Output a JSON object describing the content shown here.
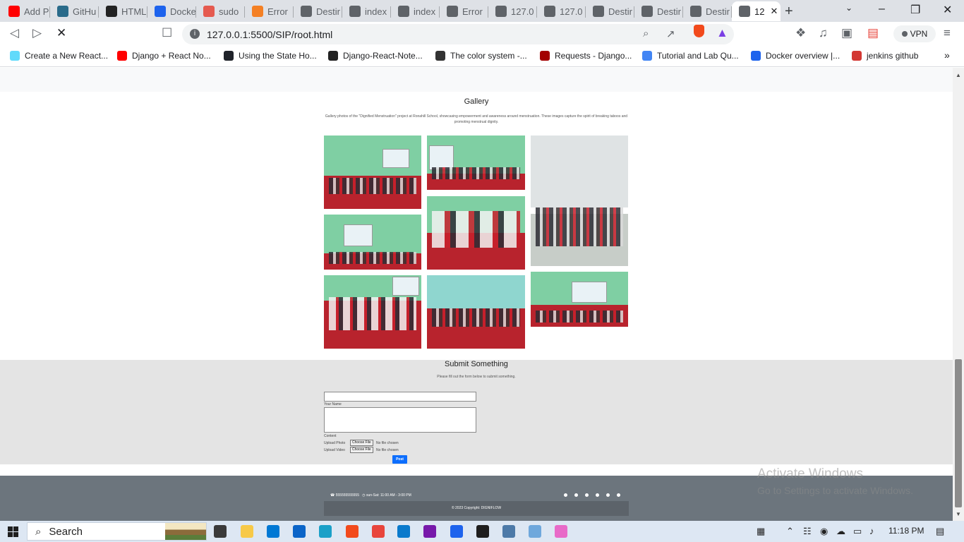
{
  "browser": {
    "tabs": [
      {
        "title": "Add P",
        "color": "#ff0000"
      },
      {
        "title": "GitHu",
        "color": "#2a6b8a"
      },
      {
        "title": "HTML",
        "color": "#222222"
      },
      {
        "title": "Docke",
        "color": "#1d63ed"
      },
      {
        "title": "sudo",
        "color": "#e55a4f"
      },
      {
        "title": "Error",
        "color": "#f48024"
      },
      {
        "title": "Destir",
        "color": "#5f6368"
      },
      {
        "title": "index",
        "color": "#5f6368"
      },
      {
        "title": "index",
        "color": "#5f6368"
      },
      {
        "title": "Error",
        "color": "#5f6368"
      },
      {
        "title": "127.0",
        "color": "#5f6368"
      },
      {
        "title": "127.0",
        "color": "#5f6368"
      },
      {
        "title": "Destir",
        "color": "#5f6368"
      },
      {
        "title": "Destir",
        "color": "#5f6368"
      },
      {
        "title": "Destir",
        "color": "#5f6368"
      },
      {
        "title": "12",
        "color": "#5f6368",
        "active": true
      }
    ],
    "url": "127.0.0.1:5500/SIP/root.html",
    "vpn_label": "VPN",
    "bookmarks": [
      {
        "title": "Create a New React...",
        "color": "#61dafb"
      },
      {
        "title": "Django + React No...",
        "color": "#ff0000"
      },
      {
        "title": "Using the State Ho...",
        "color": "#20232a"
      },
      {
        "title": "Django-React-Note...",
        "color": "#222222"
      },
      {
        "title": "The color system -...",
        "color": "#333333"
      },
      {
        "title": "Requests - Django...",
        "color": "#a30000"
      },
      {
        "title": "Tutorial and Lab Qu...",
        "color": "#4285f4"
      },
      {
        "title": "Docker overview |...",
        "color": "#1d63ed"
      },
      {
        "title": "jenkins github",
        "color": "#d33833"
      }
    ]
  },
  "page": {
    "gallery": {
      "title": "Gallery",
      "description": "Gallery photos of the \"Dignified Menstruation\" project at Ronahill School, showcasing empowerment and awareness around menstruation. These images capture the spirit of breaking taboos and promoting menstrual dignity."
    },
    "submit": {
      "title": "Submit Something",
      "description": "Please fill out the form below to submit something.",
      "name_label": "Your Name",
      "content_label": "Content",
      "photo_label": "Upload Photo",
      "video_label": "Upload Video",
      "choose_file": "Choose File",
      "no_file": "No file chosen",
      "post_label": "Post"
    },
    "footer": {
      "phone": "555555555555",
      "hours": "sun-Sat: 11:00 AM - 3:00 PM",
      "copyright": "© 2023 Copyright: DIGNIFLOW"
    },
    "watermark": {
      "line1": "Activate Windows",
      "line2": "Go to Settings to activate Windows."
    }
  },
  "taskbar": {
    "search_label": "Search",
    "time": "11:18 PM",
    "apps": [
      {
        "icon": "task-view-icon",
        "color": "#3a3a3a"
      },
      {
        "icon": "file-explorer-icon",
        "color": "#f7c948"
      },
      {
        "icon": "store-icon",
        "color": "#0078d4"
      },
      {
        "icon": "mail-icon",
        "color": "#0a64c8"
      },
      {
        "icon": "edge-icon",
        "color": "#1aa0c8"
      },
      {
        "icon": "brave-icon",
        "color": "#f24a1c"
      },
      {
        "icon": "chrome-icon",
        "color": "#e8453c"
      },
      {
        "icon": "vscode-icon",
        "color": "#0a7acc"
      },
      {
        "icon": "onenote-icon",
        "color": "#7719aa"
      },
      {
        "icon": "docker-icon",
        "color": "#1d63ed"
      },
      {
        "icon": "terminal-icon",
        "color": "#1e1e1e"
      },
      {
        "icon": "paint-icon",
        "color": "#4d7aa8"
      },
      {
        "icon": "notepad-icon",
        "color": "#6fa8dc"
      },
      {
        "icon": "extra-app-icon",
        "color": "#e86ac8"
      }
    ]
  }
}
